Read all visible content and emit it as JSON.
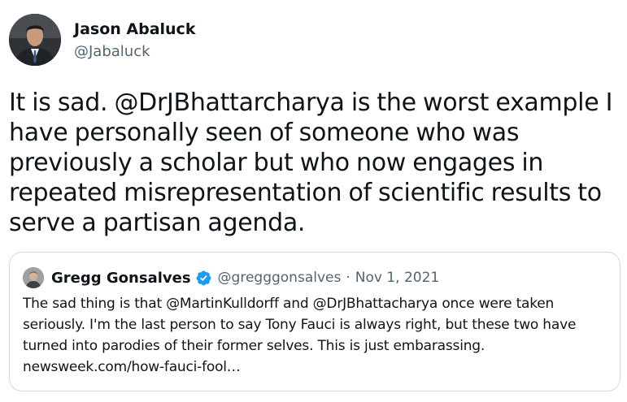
{
  "author": {
    "name": "Jason Abaluck",
    "handle": "@Jabaluck",
    "avatar_icon": "profile-photo"
  },
  "tweet": {
    "text": "It is sad. @DrJBhattarcharya is the worst example I have personally seen of someone who was previously a scholar but who now engages in repeated misrepresentation of scientific results to serve a partisan agenda."
  },
  "quoted_tweet": {
    "name": "Gregg Gonsalves",
    "verified_icon": "verified-badge-icon",
    "handle": "@gregggonsalves",
    "separator": "·",
    "date": "Nov 1, 2021",
    "text": "The sad thing is that @MartinKulldorff and @DrJBhattacharya once were taken seriously. I'm the last person to say Tony Fauci is always right, but these two have turned into parodies of their former selves. This is just embarassing. newsweek.com/how-fauci-fool…"
  },
  "colors": {
    "text_primary": "#0f1419",
    "text_secondary": "#536471",
    "border": "#cfd9de",
    "verified": "#1d9bf0"
  }
}
